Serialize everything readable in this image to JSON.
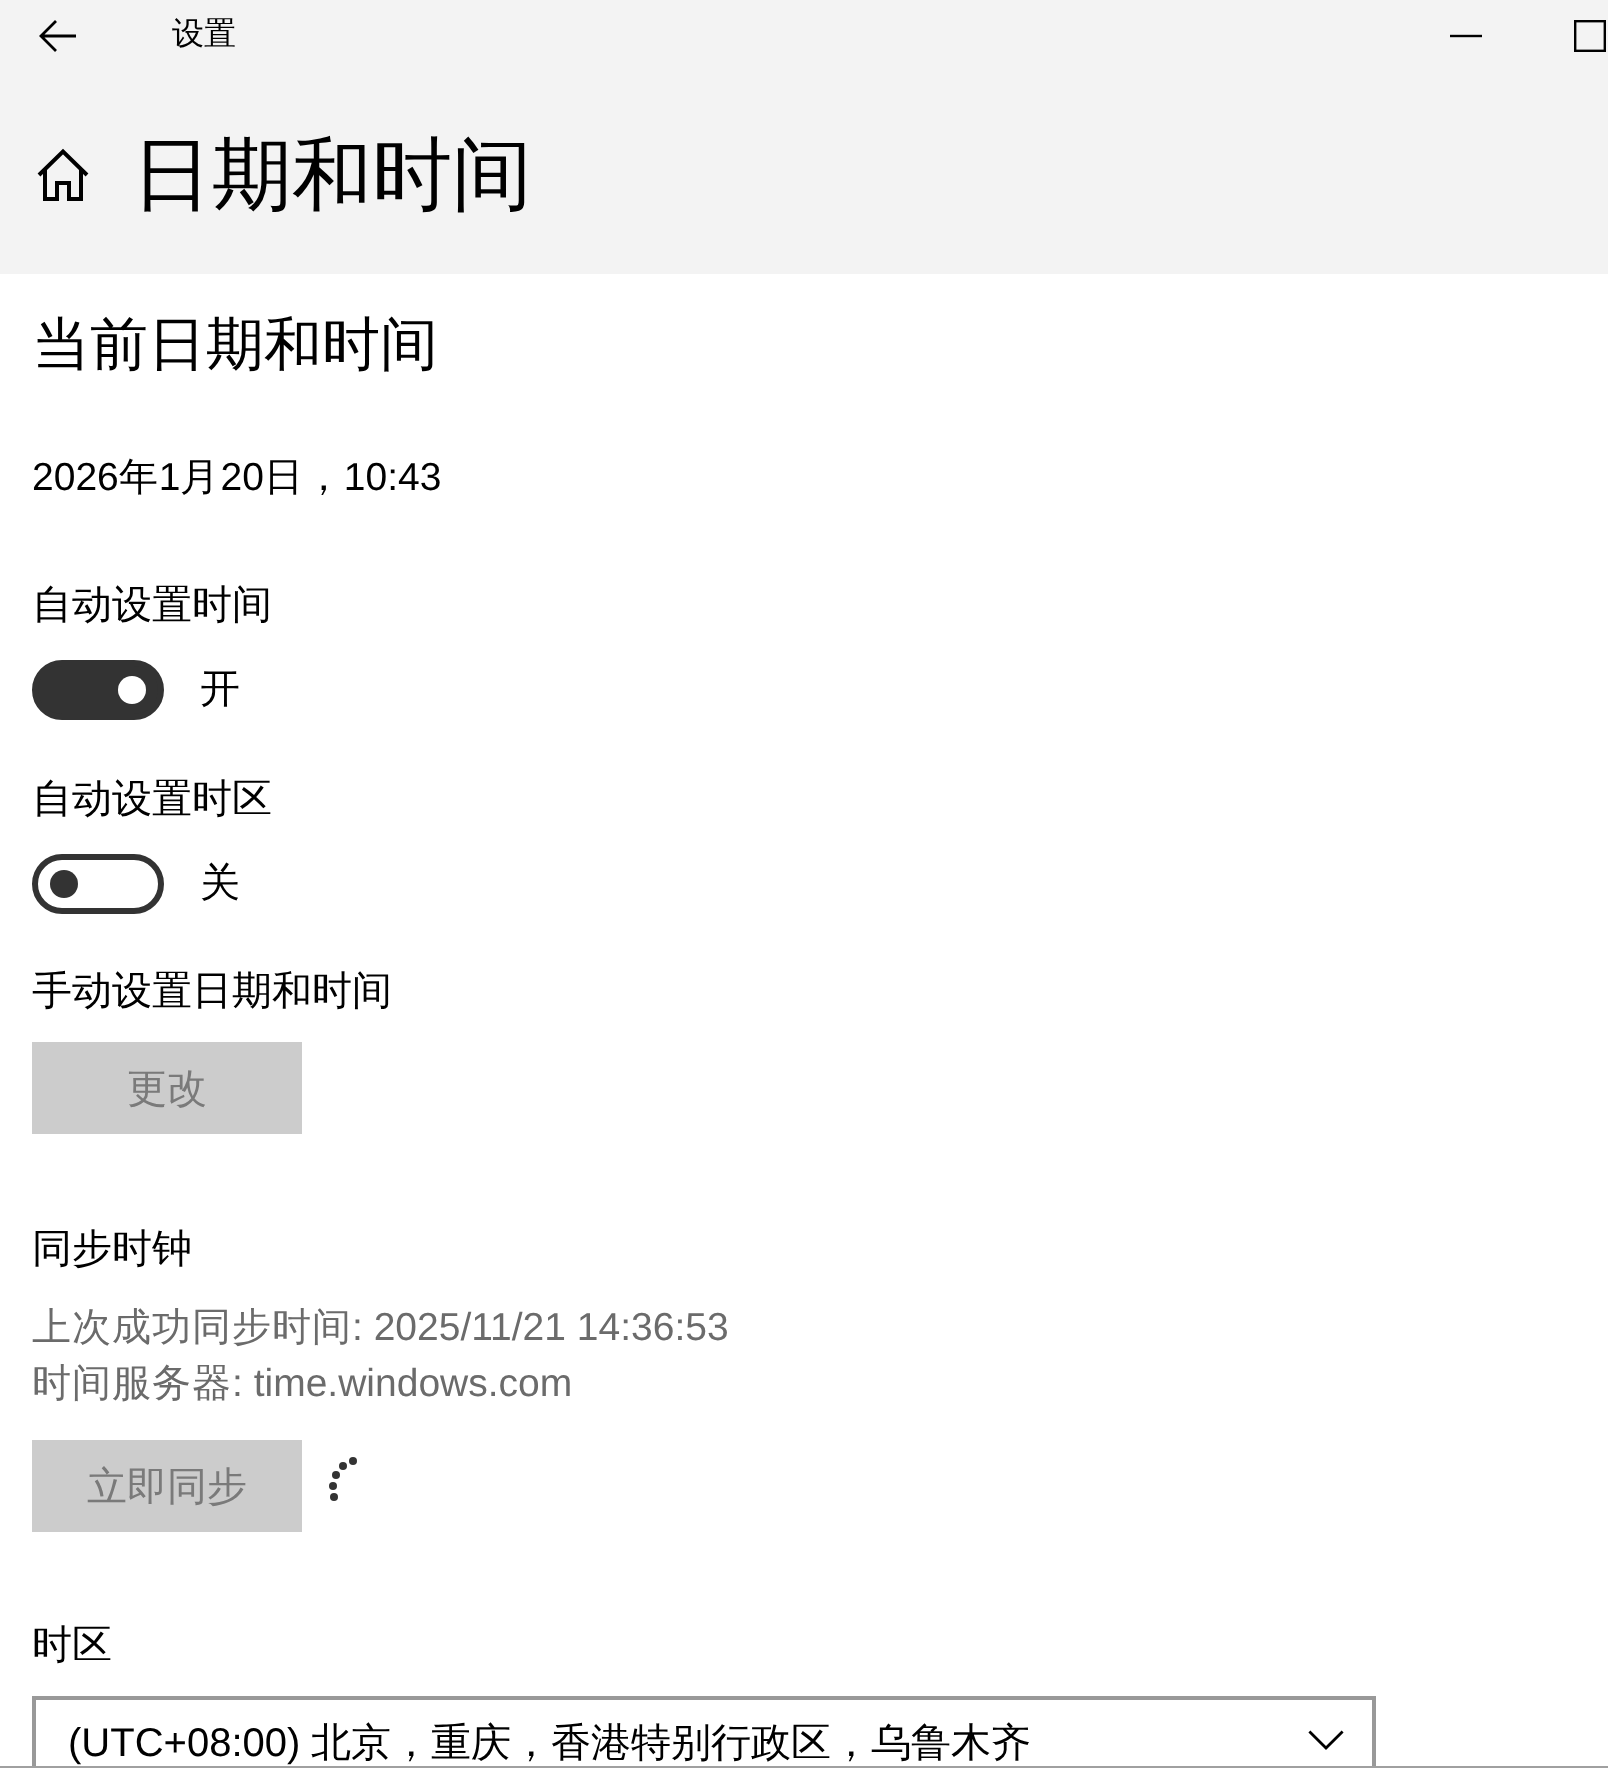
{
  "window": {
    "title": "设置"
  },
  "page": {
    "title": "日期和时间"
  },
  "current": {
    "heading": "当前日期和时间",
    "datetime": "2026年1月20日，10:43"
  },
  "settings": [
    {
      "kind": "toggle",
      "label": "自动设置时间",
      "on": true,
      "state_text": "开"
    },
    {
      "kind": "toggle",
      "label": "自动设置时区",
      "on": false,
      "state_text": "关"
    },
    {
      "kind": "button",
      "label": "手动设置日期和时间",
      "button": "更改",
      "disabled": true
    }
  ],
  "sync": {
    "heading": "同步时钟",
    "last_sync": "上次成功同步时间: 2025/11/21 14:36:53",
    "server": "时间服务器: time.windows.com",
    "button": "立即同步",
    "disabled": true,
    "busy": true
  },
  "timezone": {
    "label": "时区",
    "value": "(UTC+08:00) 北京，重庆，香港特别行政区，乌鲁木齐"
  }
}
